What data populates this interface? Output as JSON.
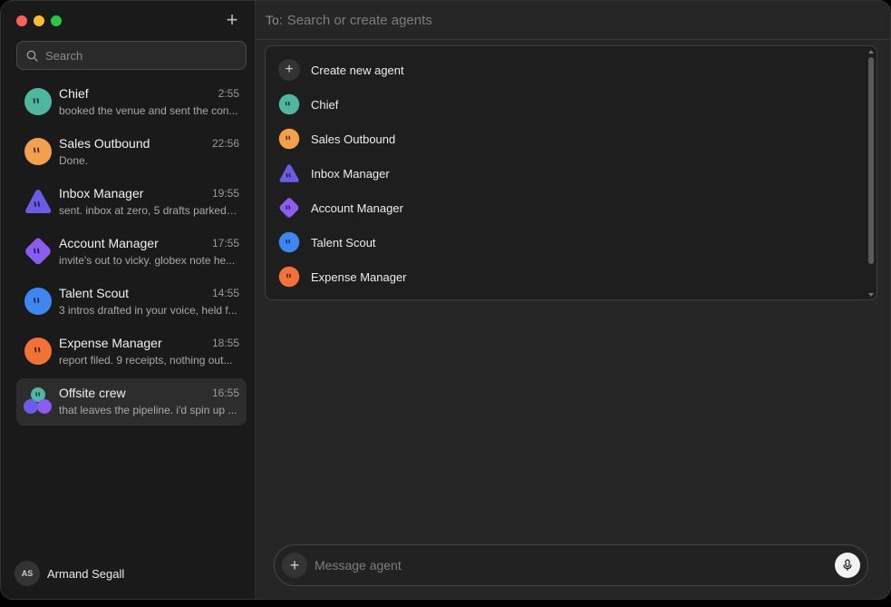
{
  "sidebar": {
    "new_label": "+",
    "search_placeholder": "Search",
    "conversations": [
      {
        "name": "Chief",
        "time": "2:55",
        "preview": "booked the venue and sent the con...",
        "color": "#4fb7a0"
      },
      {
        "name": "Sales Outbound",
        "time": "22:56",
        "preview": "Done.",
        "color": "#f2a04a"
      },
      {
        "name": "Inbox Manager",
        "time": "19:55",
        "preview": "sent. inbox at zero, 5 drafts parked ...",
        "color": "#6b5ce6"
      },
      {
        "name": "Account Manager",
        "time": "17:55",
        "preview": "invite's out to vicky. globex note he...",
        "color": "#8b5cf0"
      },
      {
        "name": "Talent Scout",
        "time": "14:55",
        "preview": "3 intros drafted in your voice, held f...",
        "color": "#3f86f0"
      },
      {
        "name": "Expense Manager",
        "time": "18:55",
        "preview": "report filed. 9 receipts, nothing out...",
        "color": "#f07236"
      },
      {
        "name": "Offsite crew",
        "time": "16:55",
        "preview": "that leaves the pipeline. i'd spin up ...",
        "color": "#4fb7a0"
      }
    ],
    "user": {
      "initials": "AS",
      "name": "Armand Segall"
    }
  },
  "main": {
    "to_label": "To:",
    "to_placeholder": "Search or create agents",
    "dropdown": {
      "create_label": "Create new agent",
      "agents": [
        {
          "name": "Chief",
          "color": "#4fb7a0"
        },
        {
          "name": "Sales Outbound",
          "color": "#f2a04a"
        },
        {
          "name": "Inbox Manager",
          "color": "#6b5ce6"
        },
        {
          "name": "Account Manager",
          "color": "#8b5cf0"
        },
        {
          "name": "Talent Scout",
          "color": "#3f86f0"
        },
        {
          "name": "Expense Manager",
          "color": "#f07236"
        }
      ]
    },
    "composer": {
      "placeholder": "Message agent"
    }
  }
}
